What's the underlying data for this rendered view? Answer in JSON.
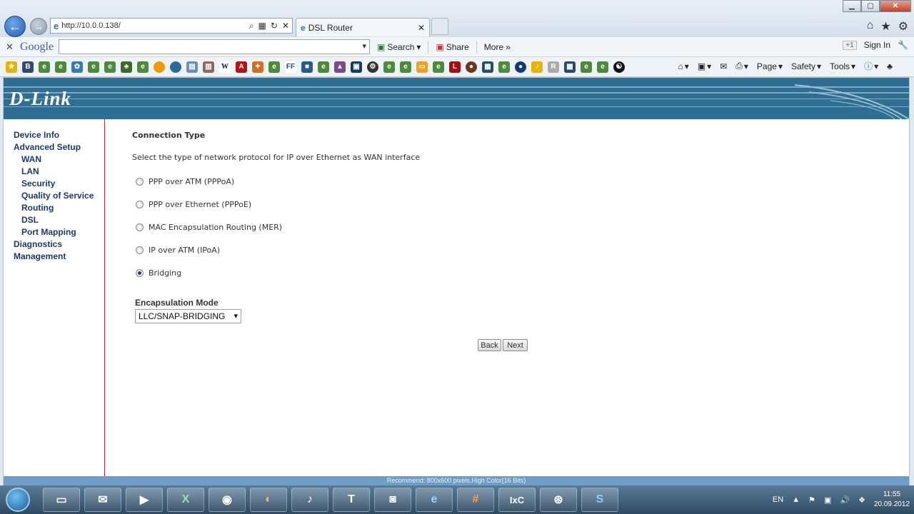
{
  "browser": {
    "url": "http://10.0.0.138/",
    "tab_title": "DSL Router",
    "google_logo": "Google",
    "toolbar": {
      "search": "Search",
      "share": "Share",
      "more": "More",
      "gplus": "+1",
      "sign_in": "Sign In"
    },
    "commands": {
      "page": "Page",
      "safety": "Safety",
      "tools": "Tools"
    }
  },
  "brand": {
    "logo": "D-Link"
  },
  "sidebar": {
    "items": [
      {
        "label": "Device Info",
        "level": "top"
      },
      {
        "label": "Advanced Setup",
        "level": "top"
      },
      {
        "label": "WAN",
        "level": "sub"
      },
      {
        "label": "LAN",
        "level": "sub"
      },
      {
        "label": "Security",
        "level": "sub"
      },
      {
        "label": "Quality of Service",
        "level": "sub"
      },
      {
        "label": "Routing",
        "level": "sub"
      },
      {
        "label": "DSL",
        "level": "sub"
      },
      {
        "label": "Port Mapping",
        "level": "sub"
      },
      {
        "label": "Diagnostics",
        "level": "top"
      },
      {
        "label": "Management",
        "level": "top"
      }
    ]
  },
  "main": {
    "title": "Connection Type",
    "description": "Select the type of network protocol for IP over Ethernet as WAN interface",
    "options": [
      {
        "label": "PPP over ATM (PPPoA)",
        "checked": false
      },
      {
        "label": "PPP over Ethernet (PPPoE)",
        "checked": false
      },
      {
        "label": "MAC Encapsulation Routing (MER)",
        "checked": false
      },
      {
        "label": "IP over ATM (IPoA)",
        "checked": false
      },
      {
        "label": "Bridging",
        "checked": true
      }
    ],
    "encapsulation": {
      "label": "Encapsulation Mode",
      "selected": "LLC/SNAP-BRIDGING"
    },
    "buttons": {
      "back": "Back",
      "next": "Next"
    }
  },
  "footer": {
    "text": "Recommend: 800x600 pixels,High Color(16 Bits)"
  },
  "taskbar": {
    "lang": "EN",
    "time": "11:55",
    "date": "20.09.2012"
  }
}
